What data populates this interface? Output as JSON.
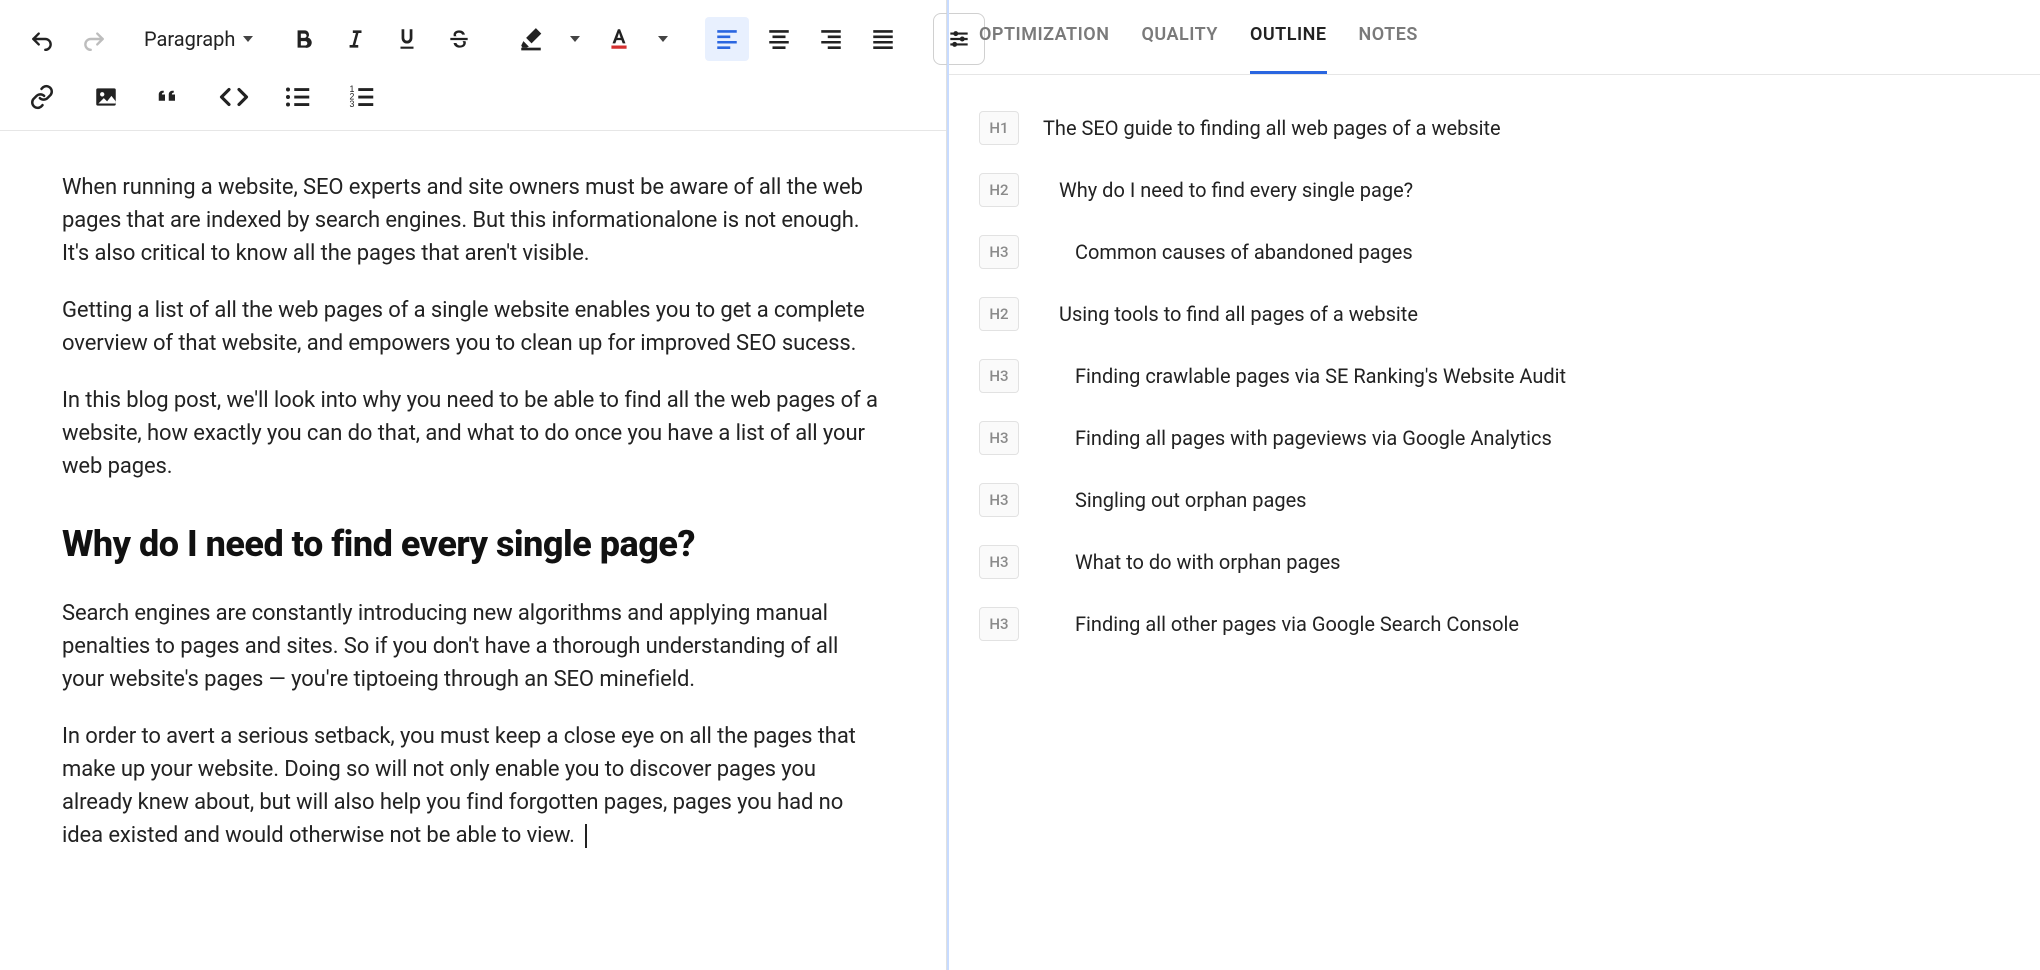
{
  "toolbar": {
    "block_type": "Paragraph"
  },
  "content": {
    "p1": "When running a website, SEO experts and site owners must be aware of all the web pages that are indexed by search engines. But this informationalone is not enough. It's also critical to know all the pages that aren't visible.",
    "p2": "Getting a list of all the web pages of a single website enables you to get a complete overview of that website, and empowers you to clean up for improved SEO sucess.",
    "p3": "In this blog post, we'll look into why you need to be able to find all the web pages of a website, how exactly you can do that, and what to do once you have a list of all your web pages.",
    "h2": "Why do I need to find every single page?",
    "p4": "Search engines are constantly introducing new algorithms and applying manual penalties to pages and sites. So if you don't have a thorough understanding of all your website's pages — you're tiptoeing through an SEO minefield.",
    "p5": "In order to avert a serious setback, you must keep a close eye on all the pages that make up your website. Doing so will not only enable you to discover pages you already knew about, but will also help you find forgotten pages, pages you had no idea existed and would otherwise not be able to view."
  },
  "sidebar": {
    "tabs": {
      "optimization": "OPTIMIZATION",
      "quality": "QUALITY",
      "outline": "OUTLINE",
      "notes": "NOTES"
    },
    "outline": [
      {
        "level": "H1",
        "text": "The SEO guide to finding all web pages of a website",
        "cls": "lvl-h1"
      },
      {
        "level": "H2",
        "text": "Why do I need to find every single page?",
        "cls": "lvl-h2"
      },
      {
        "level": "H3",
        "text": "Common causes of abandoned pages",
        "cls": "lvl-h3"
      },
      {
        "level": "H2",
        "text": "Using tools to find all pages of a website",
        "cls": "lvl-h2"
      },
      {
        "level": "H3",
        "text": "Finding crawlable pages via SE Ranking's Website Audit",
        "cls": "lvl-h3"
      },
      {
        "level": "H3",
        "text": "Finding all pages with pageviews via Google Analytics",
        "cls": "lvl-h3"
      },
      {
        "level": "H3",
        "text": "Singling out orphan pages",
        "cls": "lvl-h3"
      },
      {
        "level": "H3",
        "text": "What to do with orphan pages",
        "cls": "lvl-h3"
      },
      {
        "level": "H3",
        "text": "Finding all other pages via Google Search Console",
        "cls": "lvl-h3"
      }
    ]
  }
}
